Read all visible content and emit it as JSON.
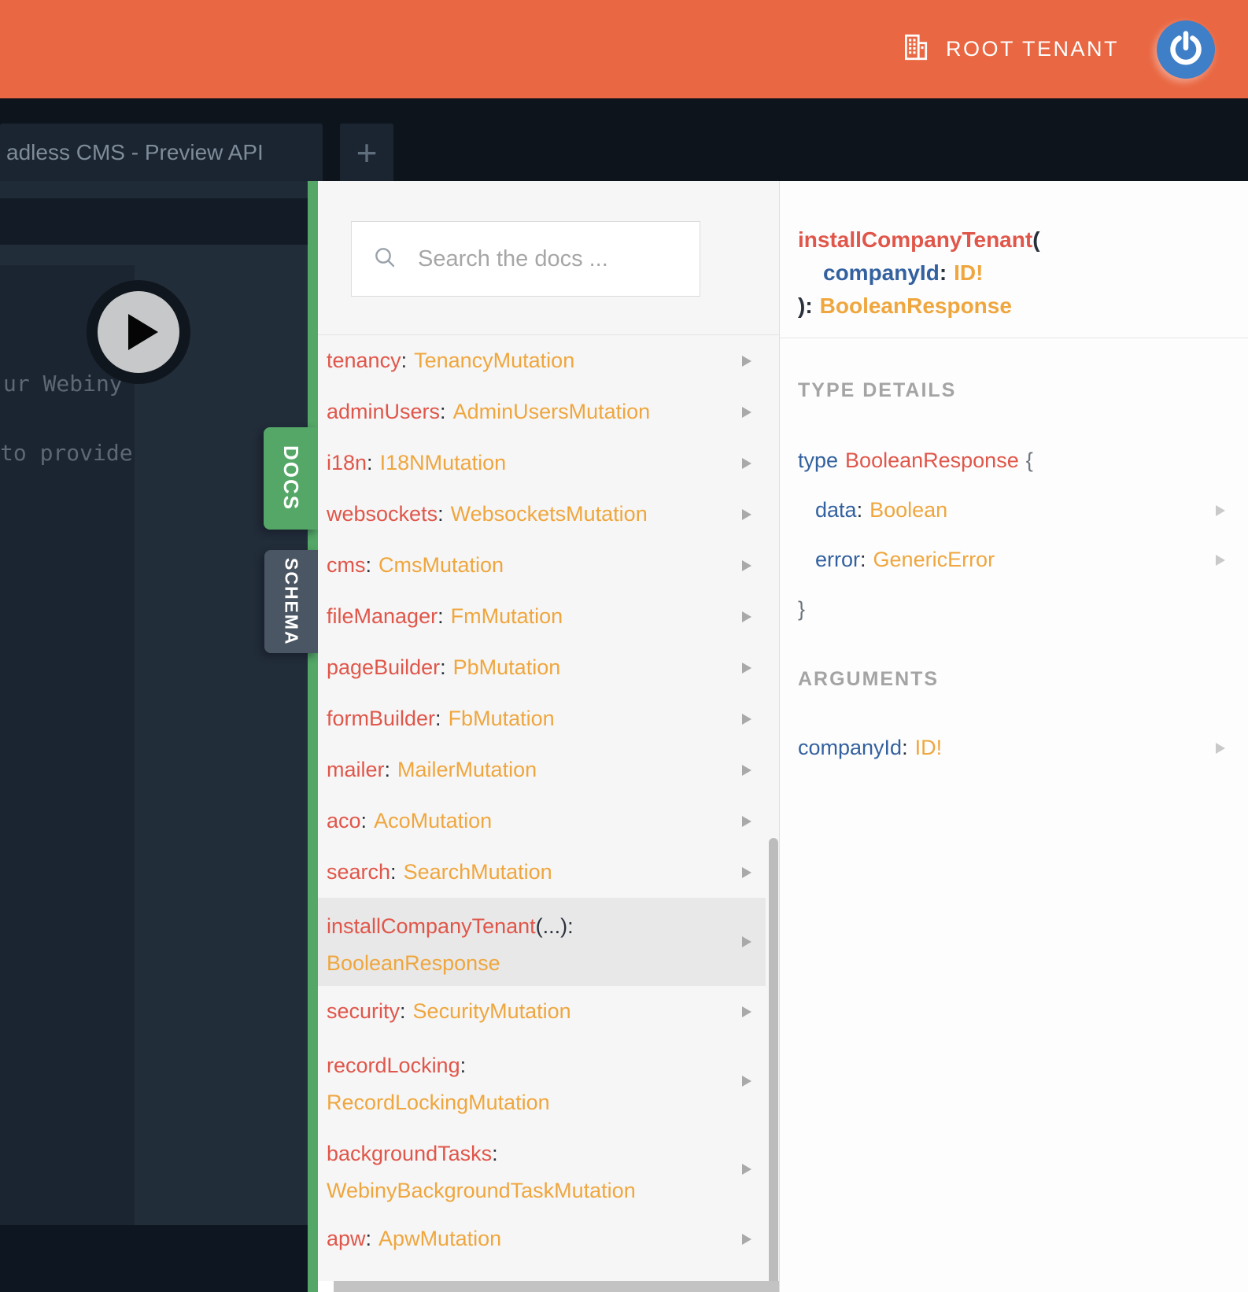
{
  "topbar": {
    "tenant": "ROOT TENANT"
  },
  "tabs": {
    "active": "adless CMS - Preview API",
    "add": "+"
  },
  "editor": {
    "code_lines": [
      "ur Webiny",
      "to provide"
    ]
  },
  "side_tabs": {
    "docs": "DOCS",
    "schema": "SCHEMA"
  },
  "punct": {
    "colon": ":",
    "open_paren": "(",
    "close_paren_colon": "):",
    "open_brace": "{",
    "close_brace": "}"
  },
  "docs_panel": {
    "search_placeholder": "Search the docs ...",
    "fields": [
      {
        "name": "tenancy",
        "type": "TenancyMutation"
      },
      {
        "name": "adminUsers",
        "type": "AdminUsersMutation"
      },
      {
        "name": "i18n",
        "type": "I18NMutation"
      },
      {
        "name": "websockets",
        "type": "WebsocketsMutation"
      },
      {
        "name": "cms",
        "type": "CmsMutation"
      },
      {
        "name": "fileManager",
        "type": "FmMutation"
      },
      {
        "name": "pageBuilder",
        "type": "PbMutation"
      },
      {
        "name": "formBuilder",
        "type": "FbMutation"
      },
      {
        "name": "mailer",
        "type": "MailerMutation"
      },
      {
        "name": "aco",
        "type": "AcoMutation"
      },
      {
        "name": "search",
        "type": "SearchMutation"
      },
      {
        "name": "installCompanyTenant",
        "suffix": "(...):",
        "type": "BooleanResponse"
      },
      {
        "name": "security",
        "type": "SecurityMutation"
      },
      {
        "name": "recordLocking",
        "type": "RecordLockingMutation"
      },
      {
        "name": "backgroundTasks",
        "type": "WebinyBackgroundTaskMutation"
      },
      {
        "name": "apw",
        "type": "ApwMutation"
      }
    ]
  },
  "detail_panel": {
    "signature": {
      "name": "installCompanyTenant",
      "open": "(",
      "arg_name": "companyId",
      "colon": ":",
      "arg_type": "ID!",
      "close": "):",
      "return_type": "BooleanResponse"
    },
    "sections": {
      "type_details_heading": "TYPE DETAILS",
      "type_keyword": "type",
      "type_name": "BooleanResponse",
      "type_fields": [
        {
          "name": "data",
          "type": "Boolean"
        },
        {
          "name": "error",
          "type": "GenericError"
        }
      ],
      "arguments_heading": "ARGUMENTS",
      "arguments": [
        {
          "name": "companyId",
          "type": "ID!"
        }
      ]
    }
  },
  "colors": {
    "topbar_orange": "#e96742",
    "docs_green": "#54a767",
    "schema_slate": "#4a5663",
    "field_red": "#e0564a",
    "type_orange": "#efa63e",
    "keyword_blue": "#33619f"
  }
}
